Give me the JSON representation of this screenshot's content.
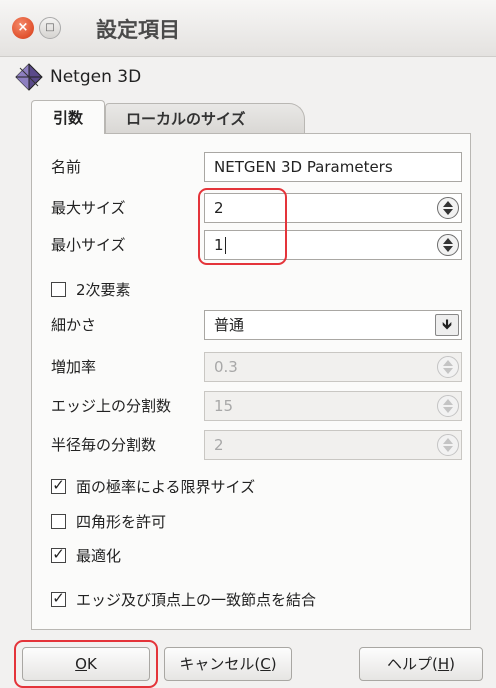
{
  "window": {
    "title": "設定項目",
    "close_glyph": "×",
    "min_glyph": "□"
  },
  "algorithm": {
    "name": "Netgen 3D"
  },
  "tabs": [
    {
      "label": "引数",
      "active": true
    },
    {
      "label": "ローカルのサイズ",
      "active": false
    }
  ],
  "fields": {
    "name": {
      "label": "名前",
      "value": "NETGEN 3D Parameters"
    },
    "max_size": {
      "label": "最大サイズ",
      "value": "2"
    },
    "min_size": {
      "label": "最小サイズ",
      "value": "1"
    },
    "second_order": {
      "label": "2次要素",
      "checked": false
    },
    "fineness": {
      "label": "細かさ",
      "value": "普通",
      "arrow": "🡻"
    },
    "growth_rate": {
      "label": "増加率",
      "value": "0.3"
    },
    "seg_per_edge": {
      "label": "エッジ上の分割数",
      "value": "15"
    },
    "seg_per_radius": {
      "label": "半径毎の分割数",
      "value": "2"
    },
    "surface_curvature": {
      "label": "面の極率による限界サイズ",
      "checked": true
    },
    "allow_quad": {
      "label": "四角形を許可",
      "checked": false
    },
    "optimize": {
      "label": "最適化",
      "checked": true
    },
    "fuse_edges": {
      "label": "エッジ及び頂点上の一致節点を結合",
      "checked": true
    }
  },
  "check_glyph": "✓",
  "buttons": {
    "ok": {
      "mnemonic": "O",
      "rest": "K"
    },
    "cancel": {
      "pre": "キャンセル(",
      "mnemonic": "C",
      "post": ")"
    },
    "help": {
      "pre": "ヘルプ(",
      "mnemonic": "H",
      "post": ")"
    }
  },
  "colors": {
    "highlight": "#e4343a",
    "close": "#e0502c"
  }
}
